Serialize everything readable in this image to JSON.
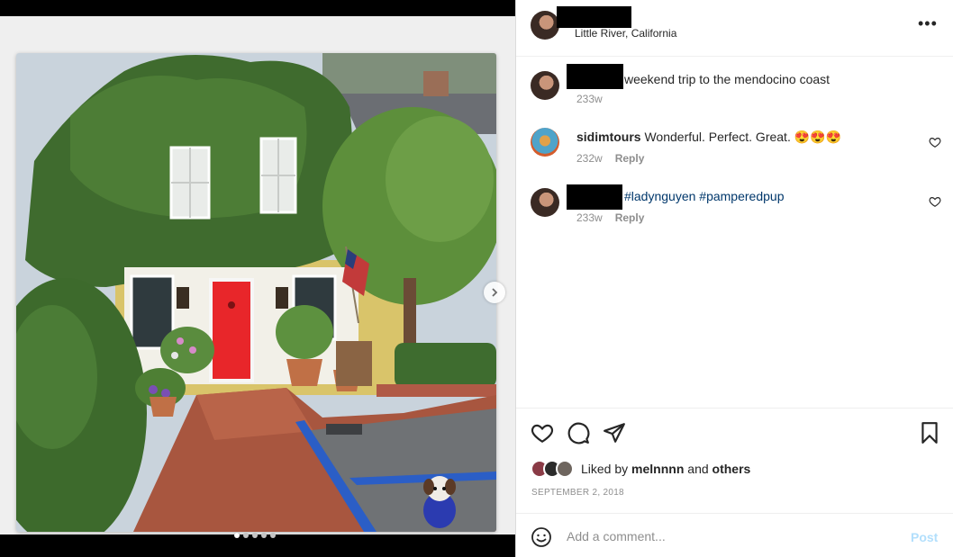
{
  "post": {
    "location": "Little River, California",
    "more_icon": "more-horizontal-icon",
    "photo_alt": "Ivy-covered house with red door, brick walkway and small dog",
    "carousel": {
      "slides": 5,
      "active_index": 0
    }
  },
  "comments": [
    {
      "user": "",
      "text": "weekend trip to the mendocino coast",
      "time": "233w",
      "reply_label": ""
    },
    {
      "user": "sidimtours",
      "text": "Wonderful. Perfect. Great. 😍😍😍",
      "time": "232w",
      "reply_label": "Reply"
    },
    {
      "user": "",
      "text": "#ladynguyen #pamperedpup",
      "time": "233w",
      "reply_label": "Reply"
    }
  ],
  "likes": {
    "prefix": "Liked by",
    "user": "melnnnn",
    "joiner": "and",
    "others": "others"
  },
  "date": "SEPTEMBER 2, 2018",
  "add_comment": {
    "placeholder": "Add a comment...",
    "post_label": "Post"
  },
  "colors": {
    "post_button_disabled": "#b2dffc",
    "hashtag": "#00376b",
    "door": "#e8262a"
  }
}
